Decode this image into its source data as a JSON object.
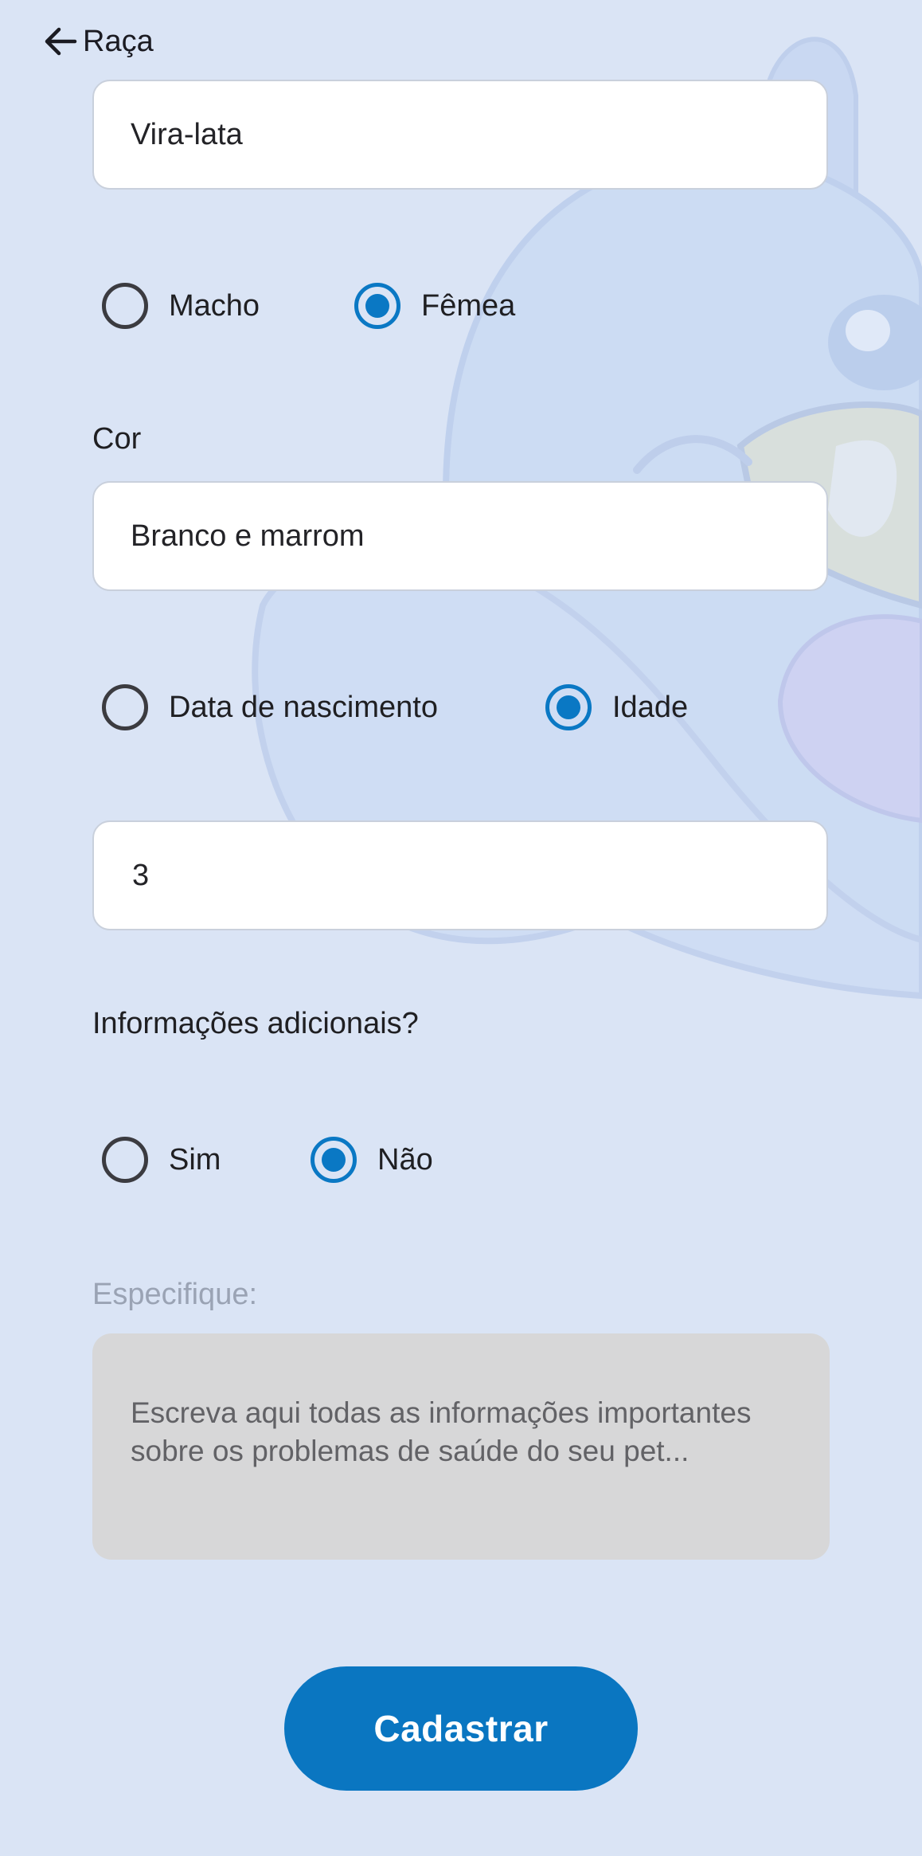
{
  "header": {
    "back_label": "Raça"
  },
  "breed": {
    "value": "Vira-lata"
  },
  "sex": {
    "options": [
      {
        "label": "Macho",
        "checked": false
      },
      {
        "label": "Fêmea",
        "checked": true
      }
    ]
  },
  "color": {
    "label": "Cor",
    "value": "Branco e marrom"
  },
  "age_mode": {
    "options": [
      {
        "label": "Data de nascimento",
        "checked": false
      },
      {
        "label": "Idade",
        "checked": true
      }
    ]
  },
  "age": {
    "value": "3"
  },
  "additional_info": {
    "label": "Informações adicionais?",
    "options": [
      {
        "label": "Sim",
        "checked": false
      },
      {
        "label": "Não",
        "checked": true
      }
    ]
  },
  "specify": {
    "label": "Especifique:",
    "placeholder": "Escreva aqui todas as informações importantes sobre os problemas de saúde do seu pet..."
  },
  "submit": {
    "label": "Cadastrar"
  },
  "colors": {
    "background": "#dae4f5",
    "accent": "#0a76c1",
    "textarea_bg": "#d7d7d8"
  }
}
